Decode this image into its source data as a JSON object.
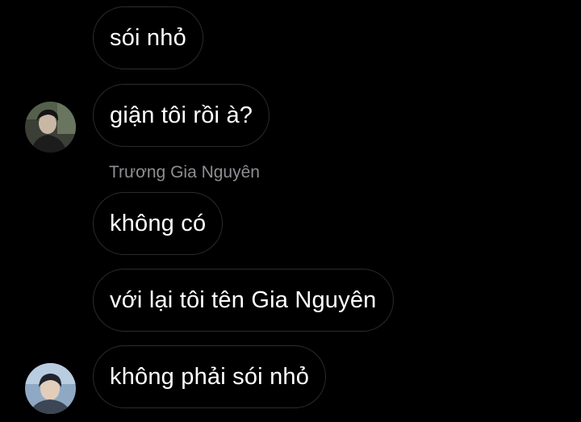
{
  "messages": [
    {
      "text": "sói nhỏ"
    },
    {
      "text": "giận tôi rồi à?"
    },
    {
      "sender": "Trương Gia Nguyên"
    },
    {
      "text": "không có"
    },
    {
      "text": "với lại tôi tên Gia Nguyên"
    },
    {
      "text": "không phải sói nhỏ"
    }
  ],
  "colors": {
    "background": "#000000",
    "bubble_border": "#2c2c2e",
    "sender_name": "#8e8e93",
    "text": "#ffffff"
  },
  "icons": {
    "avatar_1": "user-avatar-dark-photo",
    "avatar_2": "user-avatar-light-photo"
  }
}
